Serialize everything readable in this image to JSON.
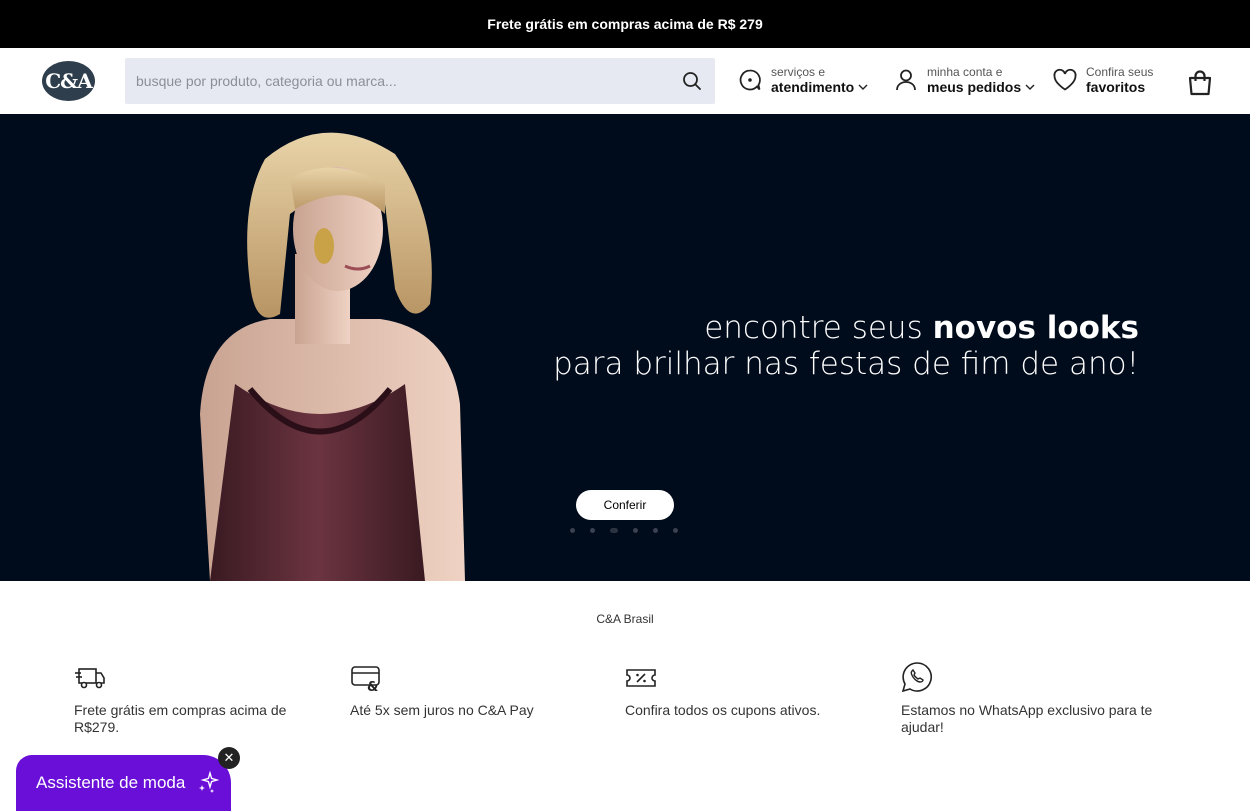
{
  "announcement": {
    "text": "Frete grátis em compras acima de R$ 279"
  },
  "header": {
    "logo_text": "C&A",
    "search": {
      "placeholder": "busque por produto, categoria ou marca...",
      "value": "",
      "icon": "search-icon"
    },
    "service": {
      "small": "serviços e",
      "big": "atendimento",
      "icon": "chat-icon"
    },
    "account": {
      "small": "minha conta e",
      "big": "meus pedidos",
      "icon": "user-icon"
    },
    "favorites": {
      "small": "Confira seus",
      "big": "favoritos",
      "icon": "heart-icon"
    },
    "cart": {
      "icon": "bag-icon"
    }
  },
  "hero": {
    "line1_regular": "encontre seus ",
    "line1_bold": "novos looks",
    "line2": "para brilhar nas festas de fim de ano!",
    "cta_label": "Conferir",
    "slide_count": 6,
    "active_slide": 3
  },
  "brand_label": "C&A Brasil",
  "benefits": [
    {
      "icon": "delivery-truck-icon",
      "text": "Frete grátis em compras acima de R$279."
    },
    {
      "icon": "card-icon",
      "text": "Até 5x sem juros no C&A Pay"
    },
    {
      "icon": "coupon-icon",
      "text": "Confira todos os cupons ativos."
    },
    {
      "icon": "whatsapp-icon",
      "text": "Estamos no WhatsApp exclusivo para te ajudar!"
    }
  ],
  "assistant": {
    "label": "Assistente de moda",
    "icon": "sparkle-icon",
    "close_icon": "close-icon"
  },
  "colors": {
    "topbar": "#000000",
    "hero_bg": "#000b1b",
    "search_bg": "#e6e9f1",
    "assistant": "#6a0fd8",
    "logo": "#2f3e4c"
  }
}
